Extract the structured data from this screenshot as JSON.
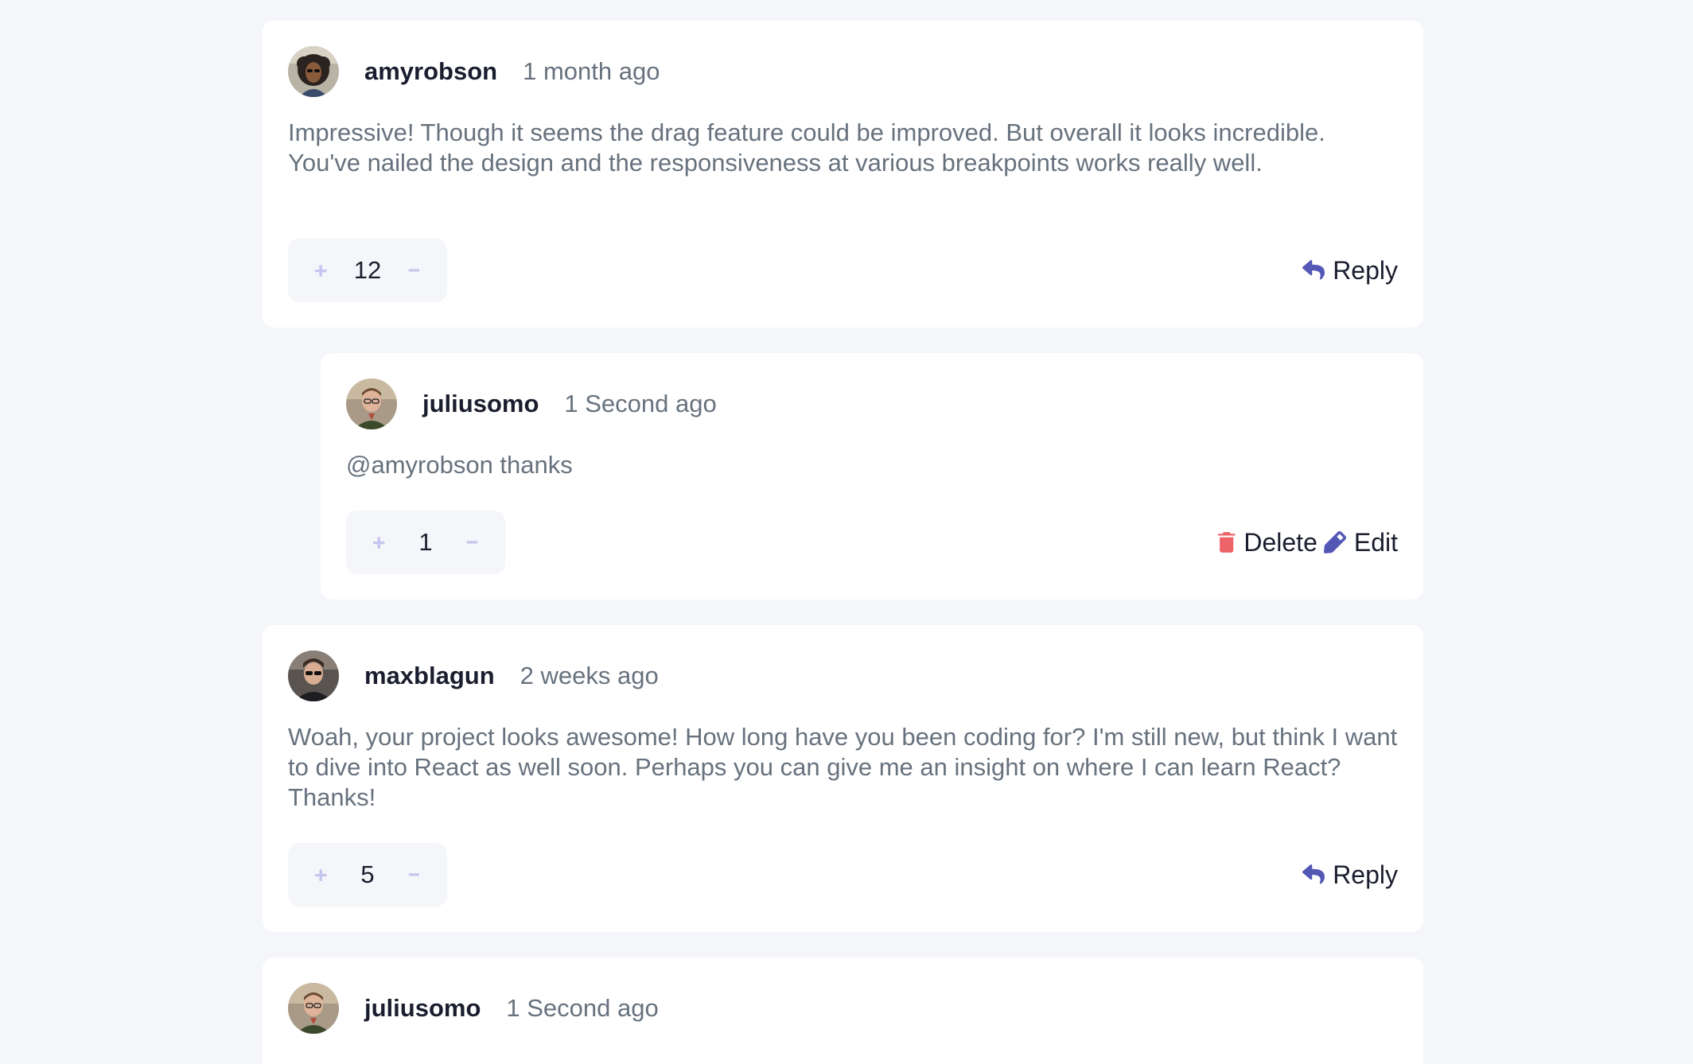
{
  "colors": {
    "background": "#f5f6fa",
    "card": "#ffffff",
    "accent": "#5357b6",
    "vote_icon": "#c5c6ef",
    "delete": "#ed6368",
    "text_dark": "#1a1d2e",
    "text_muted": "#67727e"
  },
  "comments": [
    {
      "username": "amyrobson",
      "time": "1 month ago",
      "text": "Impressive! Though it seems the drag feature could be improved. But overall it looks incredible. You've nailed the design and the responsiveness at various breakpoints works really well.",
      "score": "12",
      "reply_label": "Reply",
      "avatar_icon": "avatar-amyrobson"
    },
    {
      "username": "juliusomo",
      "time": "1 Second ago",
      "text": "@amyrobson thanks",
      "score": "1",
      "delete_label": "Delete",
      "edit_label": "Edit",
      "avatar_icon": "avatar-juliusomo"
    },
    {
      "username": "maxblagun",
      "time": "2 weeks ago",
      "text": "Woah, your project looks awesome! How long have you been coding for? I'm still new, but think I want to dive into React as well soon. Perhaps you can give me an insight on where I can learn React? Thanks!",
      "score": "5",
      "reply_label": "Reply",
      "avatar_icon": "avatar-maxblagun"
    },
    {
      "username": "juliusomo",
      "time": "1 Second ago",
      "avatar_icon": "avatar-juliusomo"
    }
  ]
}
